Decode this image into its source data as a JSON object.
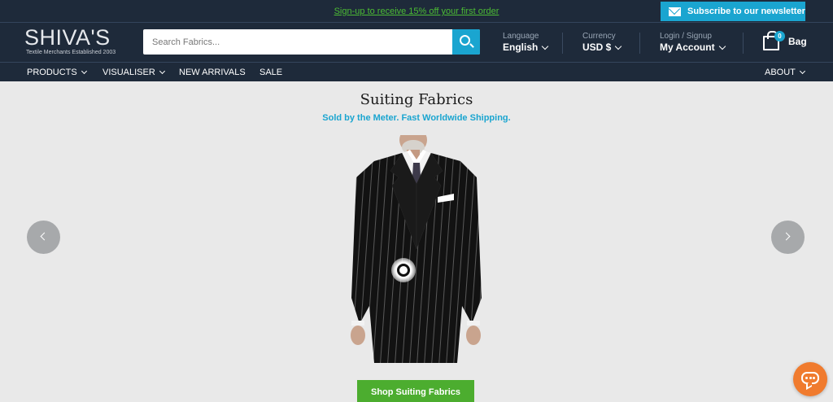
{
  "announcement": {
    "promo_text": "Sign-up to receive 15% off your first order",
    "newsletter_label": "Subscribe to our newsletter"
  },
  "header": {
    "logo_text": "SHIVA'S",
    "logo_tagline": "Textile Merchants Established 2003",
    "search_placeholder": "Search Fabrics...",
    "language_caption": "Language",
    "language_value": "English",
    "currency_caption": "Currency",
    "currency_value": "USD $",
    "account_caption": "Login / Signup",
    "account_value": "My Account",
    "bag_count": "0",
    "bag_label": "Bag"
  },
  "nav": {
    "items": [
      {
        "label": "PRODUCTS"
      },
      {
        "label": "VISUALISER"
      },
      {
        "label": "NEW ARRIVALS"
      },
      {
        "label": "SALE"
      }
    ],
    "about_label": "ABOUT"
  },
  "hero": {
    "title": "Suiting Fabrics",
    "subtitle": "Sold by the Meter. Fast Worldwide Shipping.",
    "cta_label": "Shop Suiting Fabrics"
  },
  "colors": {
    "header_bg": "#1e2a3a",
    "accent_blue": "#1aa5d0",
    "promo_green": "#4cbc34",
    "cta_green": "#4cad2f",
    "chat_orange": "#f07b2e"
  },
  "icons": {
    "newsletter": "mail-icon",
    "search": "search-icon",
    "bag": "shopping-bag-icon",
    "prev": "chevron-left-icon",
    "next": "chevron-right-icon",
    "chat": "chat-icon"
  }
}
